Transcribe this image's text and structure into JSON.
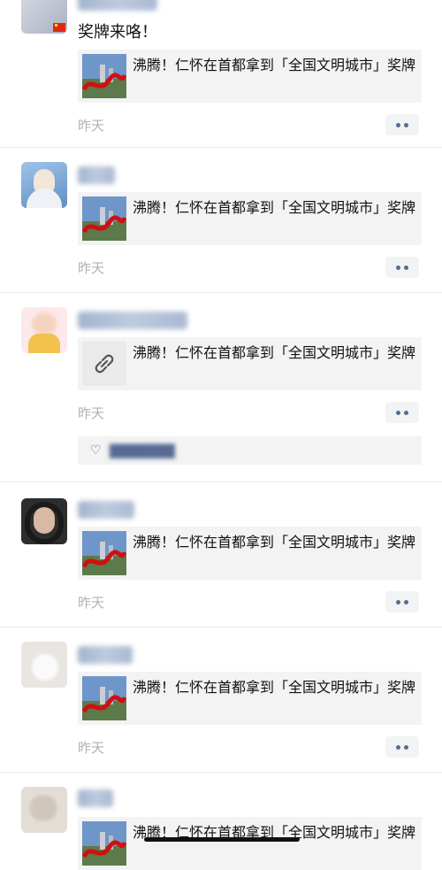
{
  "feed": {
    "posts": [
      {
        "text": "奖牌来咯！",
        "card_title": "沸腾！仁怀在首都拿到「全国文明城市」奖牌",
        "time": "昨天"
      },
      {
        "card_title": "沸腾！仁怀在首都拿到「全国文明城市」奖牌",
        "time": "昨天"
      },
      {
        "card_title": "沸腾！仁怀在首都拿到「全国文明城市」奖牌",
        "time": "昨天",
        "like_icon": "heart-icon"
      },
      {
        "card_title": "沸腾！仁怀在首都拿到「全国文明城市」奖牌",
        "time": "昨天"
      },
      {
        "card_title": "沸腾！仁怀在首都拿到「全国文明城市」奖牌",
        "time": "昨天"
      },
      {
        "card_title": "沸腾！仁怀在首都拿到「全国文明城市」奖牌"
      }
    ]
  },
  "icons": {
    "link": "link-icon",
    "more": "more-dots-icon",
    "like": "heart-icon"
  },
  "colors": {
    "link_blue": "#576b95",
    "card_bg": "#f3f3f3",
    "time_gray": "#b2b2b2"
  }
}
